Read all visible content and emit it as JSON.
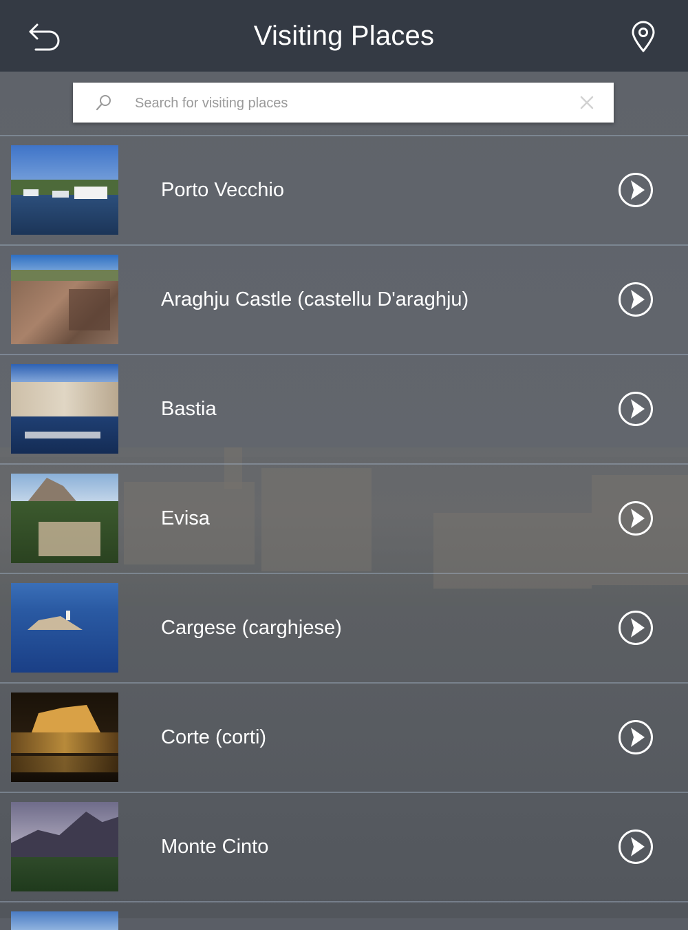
{
  "header": {
    "title": "Visiting Places"
  },
  "search": {
    "placeholder": "Search for visiting places",
    "value": ""
  },
  "places": [
    {
      "name": "Porto Vecchio"
    },
    {
      "name": "Araghju Castle (castellu D'araghju)"
    },
    {
      "name": "Bastia"
    },
    {
      "name": "Evisa"
    },
    {
      "name": "Cargese (carghjese)"
    },
    {
      "name": "Corte (corti)"
    },
    {
      "name": "Monte Cinto"
    }
  ]
}
